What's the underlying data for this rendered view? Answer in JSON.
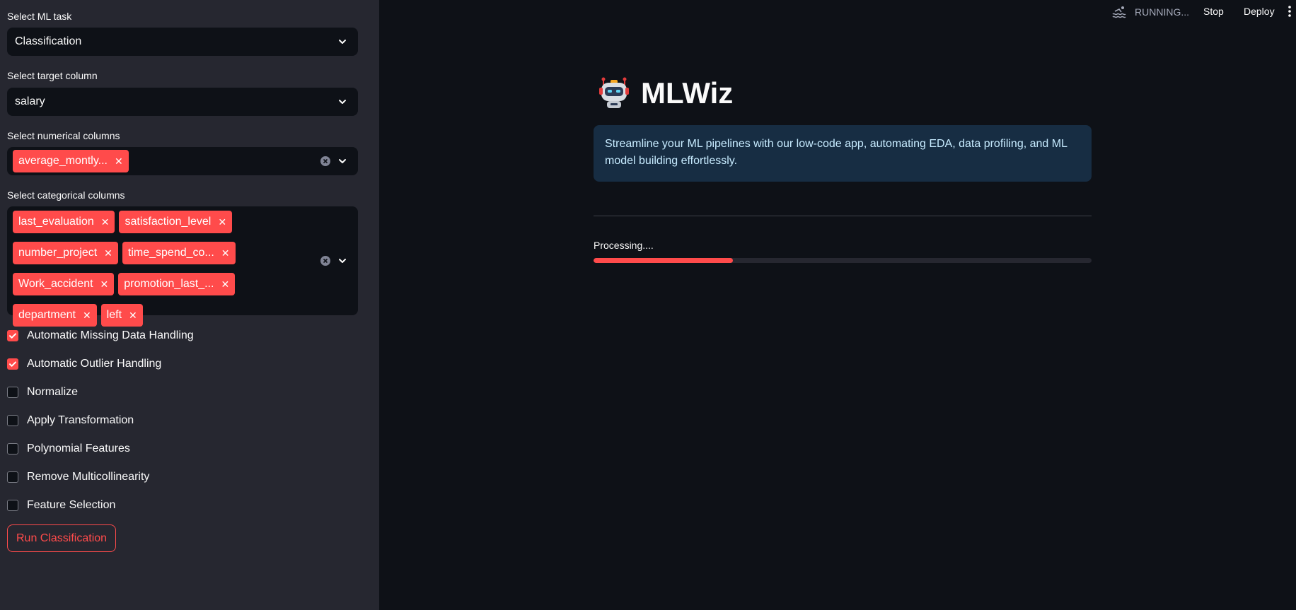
{
  "sidebar": {
    "ml_task": {
      "label": "Select ML task",
      "value": "Classification"
    },
    "target_column": {
      "label": "Select target column",
      "value": "salary"
    },
    "numerical_columns": {
      "label": "Select numerical columns",
      "tags": [
        "average_montly..."
      ]
    },
    "categorical_columns": {
      "label": "Select categorical columns",
      "tags": [
        "last_evaluation",
        "satisfaction_level",
        "number_project",
        "time_spend_co...",
        "Work_accident",
        "promotion_last_...",
        "department",
        "left"
      ]
    },
    "options": [
      {
        "label": "Automatic Missing Data Handling",
        "checked": true
      },
      {
        "label": "Automatic Outlier Handling",
        "checked": true
      },
      {
        "label": "Normalize",
        "checked": false
      },
      {
        "label": "Apply Transformation",
        "checked": false
      },
      {
        "label": "Polynomial Features",
        "checked": false
      },
      {
        "label": "Remove Multicollinearity",
        "checked": false
      },
      {
        "label": "Feature Selection",
        "checked": false
      }
    ],
    "run_button": "Run Classification"
  },
  "topbar": {
    "status": "RUNNING...",
    "stop": "Stop",
    "deploy": "Deploy"
  },
  "main": {
    "title": "MLWiz",
    "info": "Streamline your ML pipelines with our low-code app, automating EDA, data profiling, and ML model building effortlessly.",
    "progress_label": "Processing....",
    "progress_value": 0.28
  },
  "colors": {
    "accent": "#ff4b4b",
    "sidebar_bg": "#262730",
    "main_bg": "#0e1117",
    "info_bg": "#172d43"
  }
}
